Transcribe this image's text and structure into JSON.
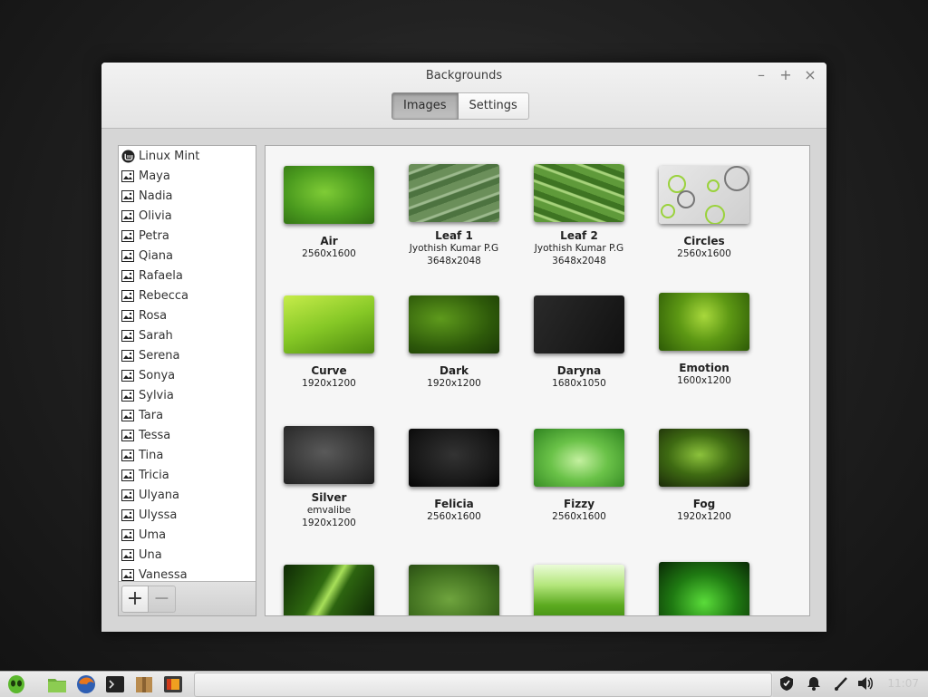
{
  "window": {
    "title": "Backgrounds",
    "tabs": [
      {
        "label": "Images",
        "active": true
      },
      {
        "label": "Settings",
        "active": false
      }
    ]
  },
  "sidebar": {
    "items": [
      "Linux Mint",
      "Maya",
      "Nadia",
      "Olivia",
      "Petra",
      "Qiana",
      "Rafaela",
      "Rebecca",
      "Rosa",
      "Sarah",
      "Serena",
      "Sonya",
      "Sylvia",
      "Tara",
      "Tessa",
      "Tina",
      "Tricia",
      "Ulyana",
      "Ulyssa",
      "Uma",
      "Una",
      "Vanessa"
    ],
    "add_label": "+",
    "remove_label": "−"
  },
  "wallpapers": [
    {
      "name": "Air",
      "author": "",
      "size": "2560x1600"
    },
    {
      "name": "Leaf 1",
      "author": "Jyothish Kumar P.G",
      "size": "3648x2048"
    },
    {
      "name": "Leaf 2",
      "author": "Jyothish Kumar P.G",
      "size": "3648x2048"
    },
    {
      "name": "Circles",
      "author": "",
      "size": "2560x1600"
    },
    {
      "name": "Curve",
      "author": "",
      "size": "1920x1200"
    },
    {
      "name": "Dark",
      "author": "",
      "size": "1920x1200"
    },
    {
      "name": "Daryna",
      "author": "",
      "size": "1680x1050"
    },
    {
      "name": "Emotion",
      "author": "",
      "size": "1600x1200"
    },
    {
      "name": "Silver",
      "author": "emvalibe",
      "size": "1920x1200"
    },
    {
      "name": "Felicia",
      "author": "",
      "size": "2560x1600"
    },
    {
      "name": "Fizzy",
      "author": "",
      "size": "2560x1600"
    },
    {
      "name": "Fog",
      "author": "",
      "size": "1920x1200"
    }
  ],
  "taskbar": {
    "clock": "11:07"
  },
  "colors": {
    "accent_green": "#6ab82b",
    "panel_bg": "#d6d6d6"
  }
}
